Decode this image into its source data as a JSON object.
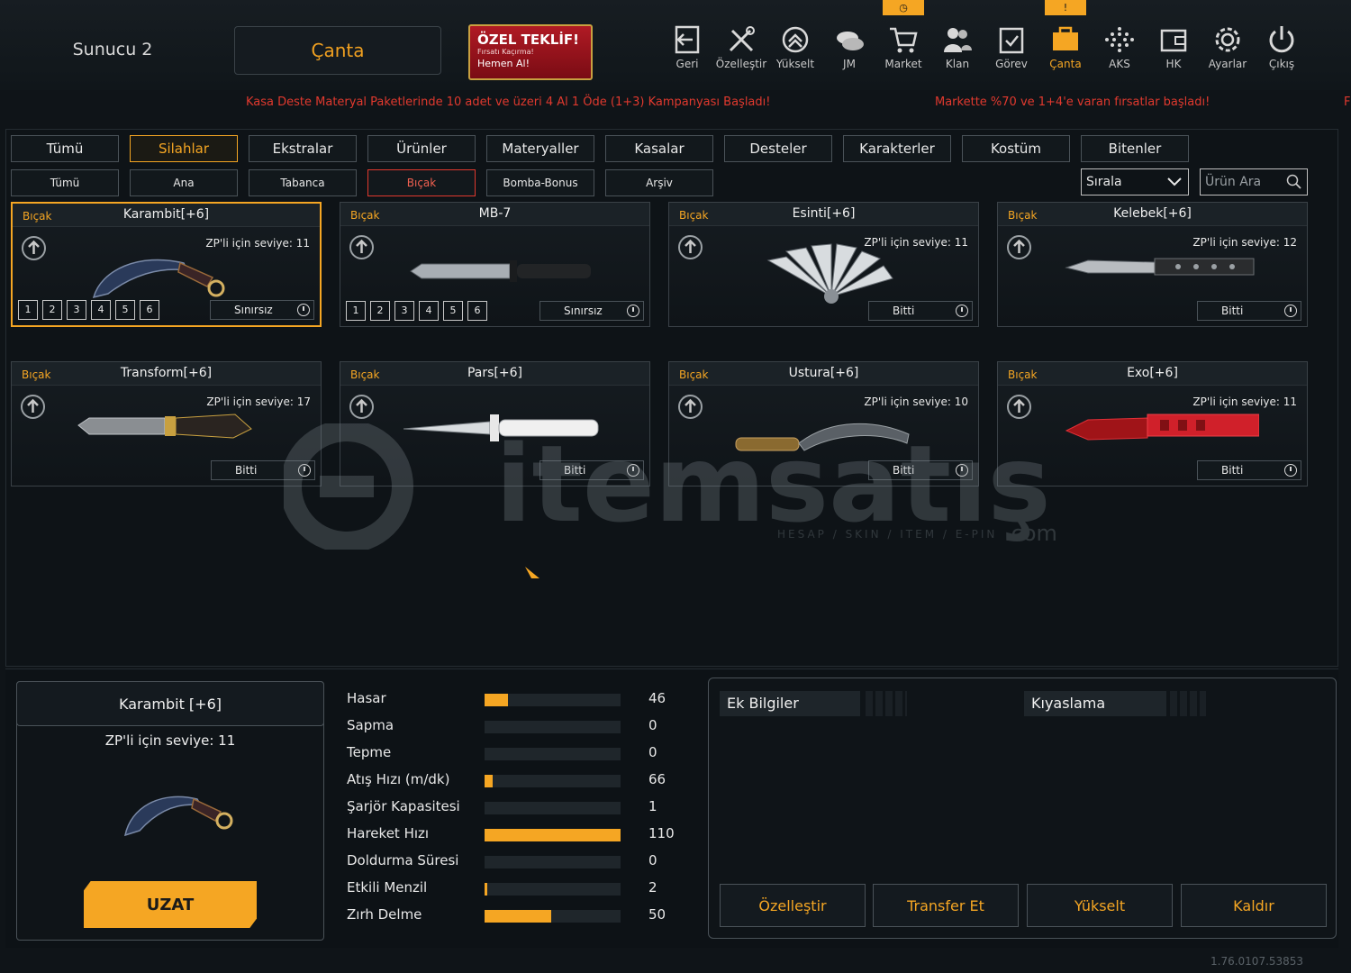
{
  "header": {
    "server": "Sunucu 2",
    "bag_title": "Çanta",
    "offer": {
      "line1": "ÖZEL TEKLİF!",
      "line2": "Fırsatı Kaçırma!",
      "line3": "Hemen Al!"
    }
  },
  "nav": [
    {
      "label": "Geri",
      "icon": "back-icon"
    },
    {
      "label": "Özelleştir",
      "icon": "tools-icon"
    },
    {
      "label": "Yükselt",
      "icon": "rank-up-icon"
    },
    {
      "label": "JM",
      "icon": "coins-icon"
    },
    {
      "label": "Market",
      "icon": "cart-icon"
    },
    {
      "label": "Klan",
      "icon": "clan-icon"
    },
    {
      "label": "Görev",
      "icon": "mission-icon"
    },
    {
      "label": "Çanta",
      "icon": "bag-icon"
    },
    {
      "label": "AKS",
      "icon": "aks-icon"
    },
    {
      "label": "HK",
      "icon": "wallet-icon"
    },
    {
      "label": "Ayarlar",
      "icon": "gear-icon"
    },
    {
      "label": "Çıkış",
      "icon": "power-icon"
    }
  ],
  "badges": {
    "market": "◷",
    "canta": "!"
  },
  "ticker": [
    "Kasa Deste Materyal Paketlerinde 10 adet ve üzeri 4 Al 1 Öde (1+3) Kampanyası Başladı!",
    "Markette %70 ve 1+4'e varan fırsatlar başladı!",
    "F"
  ],
  "tabs": [
    "Tümü",
    "Silahlar",
    "Ekstralar",
    "Ürünler",
    "Materyaller",
    "Kasalar",
    "Desteler",
    "Karakterler",
    "Kostüm",
    "Bitenler"
  ],
  "subtabs": [
    "Tümü",
    "Ana",
    "Tabanca",
    "Bıçak",
    "Bomba-Bonus",
    "Arşiv"
  ],
  "sort_label": "Sırala",
  "search_placeholder": "Ürün Ara",
  "items": [
    {
      "cat": "Bıçak",
      "name": "Karambit[+6]",
      "lvl": "ZP'li için seviye: 11",
      "status": "Sınırsız",
      "slots": [
        "1",
        "2",
        "3",
        "4",
        "5",
        "6"
      ],
      "knife": "karambit"
    },
    {
      "cat": "Bıçak",
      "name": "MB-7",
      "lvl": "",
      "status": "Sınırsız",
      "slots": [
        "1",
        "2",
        "3",
        "4",
        "5",
        "6"
      ],
      "knife": "combat"
    },
    {
      "cat": "Bıçak",
      "name": "Esinti[+6]",
      "lvl": "ZP'li için seviye: 11",
      "status": "Bitti",
      "slots": [],
      "knife": "fan"
    },
    {
      "cat": "Bıçak",
      "name": "Kelebek[+6]",
      "lvl": "ZP'li için seviye: 12",
      "status": "Bitti",
      "slots": [],
      "knife": "butterfly"
    },
    {
      "cat": "Bıçak",
      "name": "Transform[+6]",
      "lvl": "ZP'li için seviye: 17",
      "status": "Bitti",
      "slots": [],
      "knife": "transform"
    },
    {
      "cat": "Bıçak",
      "name": "Pars[+6]",
      "lvl": "",
      "status": "Bitti",
      "slots": [],
      "knife": "stiletto"
    },
    {
      "cat": "Bıçak",
      "name": "Ustura[+6]",
      "lvl": "ZP'li için seviye: 10",
      "status": "Bitti",
      "slots": [],
      "knife": "razor"
    },
    {
      "cat": "Bıçak",
      "name": "Exo[+6]",
      "lvl": "ZP'li için seviye: 11",
      "status": "Bitti",
      "slots": [],
      "knife": "exo"
    }
  ],
  "detail": {
    "name": "Karambit [+6]",
    "lvl": "ZP'li için seviye: 11",
    "button": "UZAT"
  },
  "stats": [
    {
      "label": "Hasar",
      "value": "46",
      "frac": 0.17
    },
    {
      "label": "Sapma",
      "value": "0",
      "frac": 0
    },
    {
      "label": "Tepme",
      "value": "0",
      "frac": 0
    },
    {
      "label": "Atış Hızı (m/dk)",
      "value": "66",
      "frac": 0.06
    },
    {
      "label": "Şarjör Kapasitesi",
      "value": "1",
      "frac": 0
    },
    {
      "label": "Hareket Hızı",
      "value": "110",
      "frac": 1.0
    },
    {
      "label": "Doldurma Süresi",
      "value": "0",
      "frac": 0
    },
    {
      "label": "Etkili Menzil",
      "value": "2",
      "frac": 0.02
    },
    {
      "label": "Zırh Delme",
      "value": "50",
      "frac": 0.49
    }
  ],
  "info": {
    "tab1": "Ek Bilgiler",
    "tab2": "Kıyaslama",
    "buttons": [
      "Özelleştir",
      "Transfer Et",
      "Yükselt",
      "Kaldır"
    ]
  },
  "watermark": {
    "brand": "itemsatış",
    "tagline": "HESAP / SKIN / ITEM / E-PIN",
    "suffix": ".com"
  },
  "version": "1.76.0107.53853",
  "colors": {
    "accent": "#f5a623",
    "ticker": "#e0392e",
    "offer": "#b01a24"
  }
}
